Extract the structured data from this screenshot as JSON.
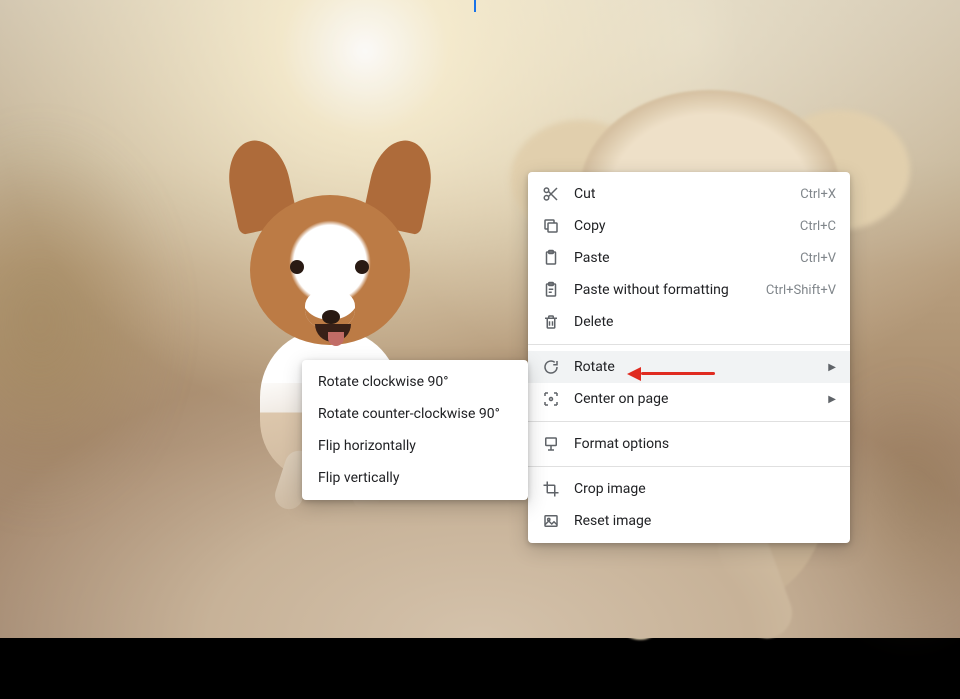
{
  "context_menu": {
    "items": [
      {
        "id": "cut",
        "icon": "scissors-icon",
        "label": "Cut",
        "shortcut": "Ctrl+X"
      },
      {
        "id": "copy",
        "icon": "copy-icon",
        "label": "Copy",
        "shortcut": "Ctrl+C"
      },
      {
        "id": "paste",
        "icon": "clipboard-icon",
        "label": "Paste",
        "shortcut": "Ctrl+V"
      },
      {
        "id": "paste-plain",
        "icon": "clipboard-text-icon",
        "label": "Paste without formatting",
        "shortcut": "Ctrl+Shift+V"
      },
      {
        "id": "delete",
        "icon": "trash-icon",
        "label": "Delete"
      },
      {
        "separator": true
      },
      {
        "id": "rotate",
        "icon": "rotate-icon",
        "label": "Rotate",
        "submenu": true,
        "hovered": true
      },
      {
        "id": "center",
        "icon": "center-icon",
        "label": "Center on page",
        "submenu": true
      },
      {
        "separator": true
      },
      {
        "id": "format",
        "icon": "format-icon",
        "label": "Format options"
      },
      {
        "separator": true
      },
      {
        "id": "crop",
        "icon": "crop-icon",
        "label": "Crop image"
      },
      {
        "id": "reset",
        "icon": "reset-image-icon",
        "label": "Reset image"
      }
    ]
  },
  "rotate_submenu": {
    "items": [
      {
        "id": "rot-cw",
        "label": "Rotate clockwise 90°"
      },
      {
        "id": "rot-ccw",
        "label": "Rotate counter-clockwise 90°"
      },
      {
        "id": "flip-h",
        "label": "Flip horizontally"
      },
      {
        "id": "flip-v",
        "label": "Flip vertically"
      }
    ]
  },
  "annotation": {
    "target": "rotate",
    "color": "#e02b20"
  },
  "background": {
    "description": "Photograph of two dogs running toward camera on a dirt path at sunset",
    "subjects": [
      "corgi-like dog (orange/white)",
      "shaggy tan dog"
    ]
  }
}
